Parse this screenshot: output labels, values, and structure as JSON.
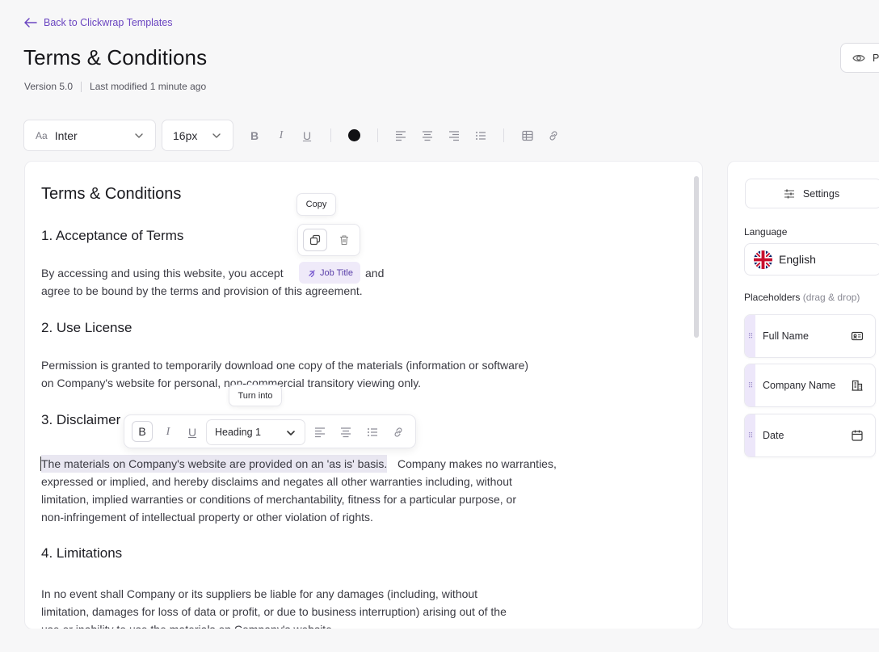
{
  "header": {
    "back_label": "Back to Clickwrap Templates",
    "title": "Terms & Conditions",
    "version": "Version 5.0",
    "last_modified": "Last modified 1 minute ago",
    "preview_label": "Pr"
  },
  "toolbar": {
    "font_prefix": "Aa",
    "font": "Inter",
    "size": "16px",
    "bold": "B",
    "italic": "I",
    "underline": "U",
    "text_color": "#111114"
  },
  "document": {
    "title": "Terms & Conditions",
    "sections": [
      {
        "heading": "1. Acceptance of Terms",
        "lines": [
          "By accessing and using this website, you accept",
          "agree to be bound by the terms and provision of this agreement."
        ],
        "line_tail": "and"
      },
      {
        "heading": "2. Use License",
        "lines": [
          "Permission is granted to temporarily download one copy of the materials (information or software)",
          "on Company's website for personal, non-commercial transitory viewing only."
        ]
      },
      {
        "heading": "3. Disclaimer",
        "lines": [
          "The materials on Company's website are provided on an 'as is' basis.",
          "expressed or implied, and hereby disclaims and negates all other warranties including, without",
          "limitation, implied warranties or conditions of merchantability, fitness for a particular purpose, or",
          "non-infringement of intellectual property or other violation of rights."
        ],
        "line_tail": "Company makes no warranties,"
      },
      {
        "heading": "4. Limitations",
        "lines": [
          "In no event shall Company or its suppliers be liable for any damages (including, without",
          "limitation, damages for loss of data or profit, or due to business interruption) arising out of the",
          "use or inability to use the materials on Company's website."
        ]
      }
    ],
    "placeholder_chip": "Job Title"
  },
  "popups": {
    "copy_tooltip": "Copy",
    "turn_into_tooltip": "Turn into",
    "heading_select": "Heading 1"
  },
  "panel": {
    "settings_label": "Settings",
    "language_label": "Language",
    "language_value": "English",
    "placeholders_label": "Placeholders",
    "placeholders_hint": "(drag & drop)",
    "placeholders": [
      {
        "label": "Full Name",
        "icon": "id-card-icon"
      },
      {
        "label": "Company Name",
        "icon": "building-icon"
      },
      {
        "label": "Date",
        "icon": "calendar-icon"
      }
    ]
  },
  "colors": {
    "accent": "#6b46c1",
    "chip_bg": "#efeaf9",
    "grip_bg": "#ede7fa"
  }
}
